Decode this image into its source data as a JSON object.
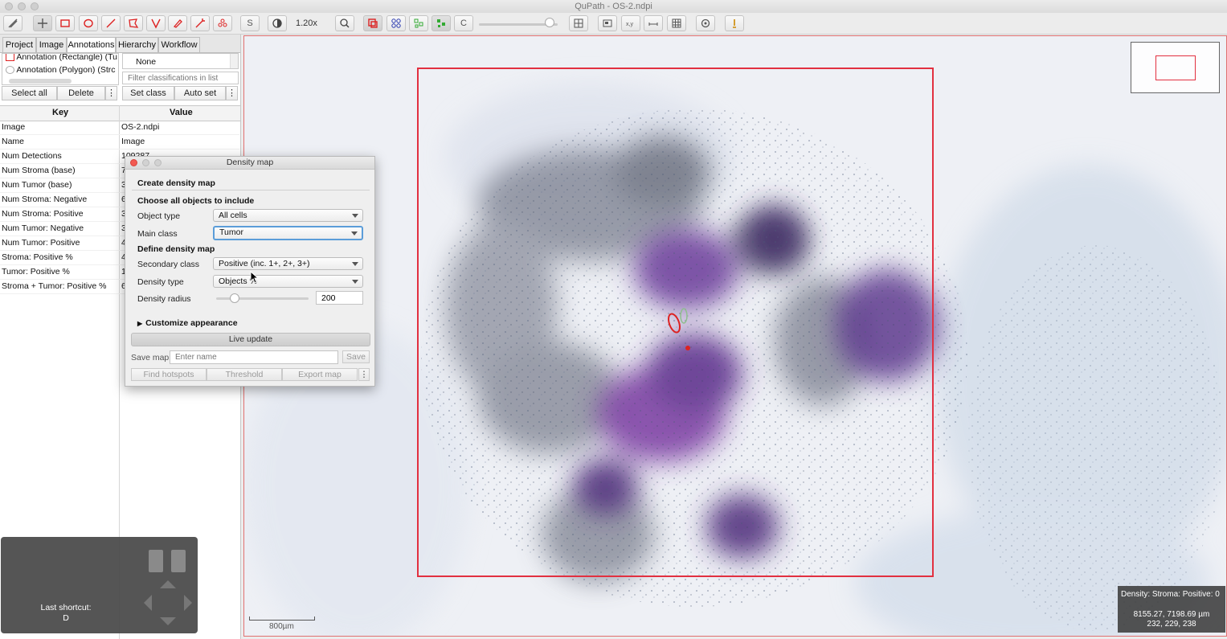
{
  "window": {
    "title": "QuPath - OS-2.ndpi"
  },
  "toolbar": {
    "zoom": "1.20x",
    "s_label": "S",
    "c_label": "C",
    "opacity": 0.9,
    "icons": [
      "move-icon",
      "pan-icon",
      "rectangle-icon",
      "ellipse-icon",
      "line-icon",
      "polygon-icon",
      "polyline-icon",
      "brush-icon",
      "wand-icon",
      "points-icon",
      "selection-mode-icon",
      "brightness-contrast-icon",
      "zoom-to-fit-icon",
      "show-annotations-icon",
      "show-tma-icon",
      "show-detections-icon",
      "fill-detections-icon",
      "show-connections-icon",
      "overview-icon",
      "location-icon",
      "scalebar-icon",
      "grid-icon",
      "settings-icon",
      "log-icon"
    ]
  },
  "left_panel": {
    "tabs": [
      "Project",
      "Image",
      "Annotations",
      "Hierarchy",
      "Workflow"
    ],
    "active_tab": "Annotations",
    "annotations": [
      "Annotation (Rectangle) (Tu",
      "Annotation (Polygon) (Strc"
    ],
    "classifications": [
      "None"
    ],
    "filter_placeholder": "Filter classifications in list",
    "buttons": {
      "select_all": "Select all",
      "delete": "Delete",
      "set_class": "Set class",
      "auto_set": "Auto set",
      "more": "⋮"
    },
    "table": {
      "headers": [
        "Key",
        "Value"
      ],
      "rows": [
        [
          "Image",
          "OS-2.ndpi"
        ],
        [
          "Name",
          "Image"
        ],
        [
          "Num Detections",
          "109287"
        ],
        [
          "Num Stroma (base)",
          "7"
        ],
        [
          "Num Tumor (base)",
          "3"
        ],
        [
          "Num Stroma: Negative",
          "6"
        ],
        [
          "Num Stroma: Positive",
          "3"
        ],
        [
          "Num Tumor: Negative",
          "3"
        ],
        [
          "Num Tumor: Positive",
          "4"
        ],
        [
          "Stroma: Positive %",
          "4"
        ],
        [
          "Tumor: Positive %",
          "1"
        ],
        [
          "Stroma + Tumor: Positive %",
          "6"
        ]
      ]
    },
    "shortcut": {
      "label": "Last shortcut:",
      "key": "D"
    }
  },
  "dialog": {
    "title": "Density map",
    "create_heading": "Create density map",
    "choose_heading": "Choose all objects to include",
    "object_type_label": "Object type",
    "object_type_value": "All cells",
    "main_class_label": "Main class",
    "main_class_value": "Tumor",
    "define_heading": "Define density map",
    "secondary_class_label": "Secondary class",
    "secondary_class_value": "Positive (inc. 1+, 2+, 3+)",
    "density_type_label": "Density type",
    "density_type_value": "Objects %",
    "density_radius_label": "Density radius",
    "density_radius_value": "200",
    "density_radius_slider": 0.2,
    "customize_label": "Customize appearance",
    "live_update_label": "Live update",
    "save_map_label": "Save map",
    "save_name_placeholder": "Enter name",
    "save_button": "Save",
    "find_hotspots": "Find hotspots",
    "threshold": "Threshold",
    "export_map": "Export map",
    "more": "⋮"
  },
  "viewer": {
    "info_line1": "Density: Stroma: Positive: 0",
    "info_line2": "8155.27, 7198.69 µm",
    "info_line3": "232, 229, 238",
    "scalebar_label": "800µm",
    "roi_color": "#e23040",
    "density_color": "#5a2a8a"
  }
}
